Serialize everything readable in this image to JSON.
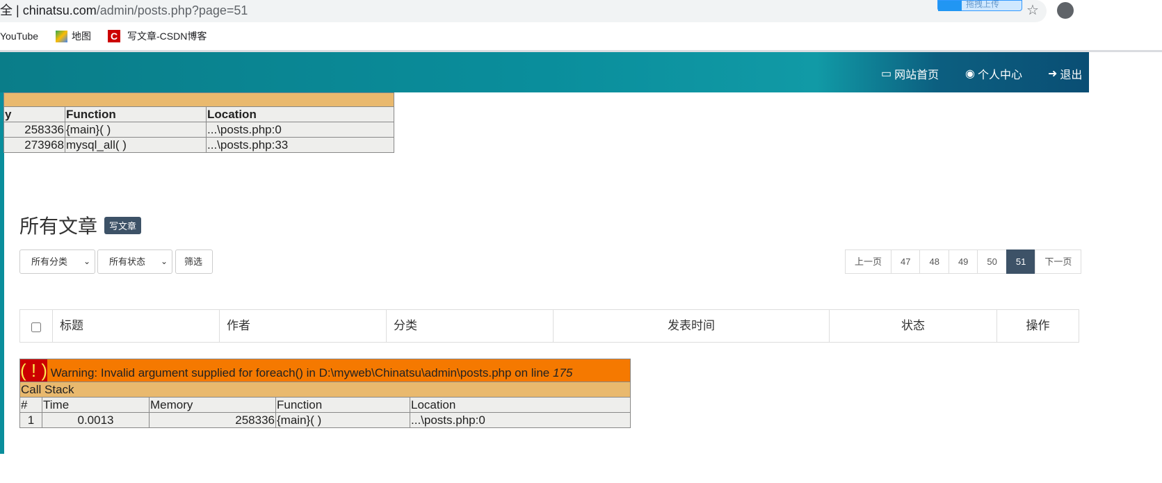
{
  "browser": {
    "address_prefix": "全 | ",
    "address_host": "chinatsu.com",
    "address_path": "/admin/posts.php?page=51",
    "extension_label": "拖拽上传",
    "bookmarks": [
      {
        "label": "YouTube"
      },
      {
        "label": "地图"
      },
      {
        "label": "写文章-CSDN博客"
      }
    ]
  },
  "header": {
    "nav": [
      {
        "label": "网站首页",
        "icon": "monitor-icon"
      },
      {
        "label": "个人中心",
        "icon": "user-circle-icon"
      },
      {
        "label": "退出",
        "icon": "sign-out-icon"
      }
    ]
  },
  "xdebug_top": {
    "headers": [
      "y",
      "Function",
      "Location"
    ],
    "rows": [
      [
        "258336",
        "{main}( )",
        "...\\posts.php:0"
      ],
      [
        "273968",
        "mysql_all( )",
        "...\\posts.php:33"
      ]
    ]
  },
  "page": {
    "title": "所有文章",
    "new_post": "写文章"
  },
  "filters": {
    "category": "所有分类",
    "status": "所有状态",
    "filter_button": "筛选"
  },
  "pagination": {
    "prev": "上一页",
    "pages": [
      "47",
      "48",
      "49",
      "50",
      "51"
    ],
    "current": "51",
    "next": "下一页"
  },
  "table": {
    "headers": [
      "标题",
      "作者",
      "分类",
      "发表时间",
      "状态",
      "操作"
    ]
  },
  "warning": {
    "icon": "( ! )",
    "message": "Warning: Invalid argument supplied for foreach() in D:\\myweb\\Chinatsu\\admin\\posts.php on line ",
    "line": "175",
    "call_stack": "Call Stack",
    "headers": [
      "#",
      "Time",
      "Memory",
      "Function",
      "Location"
    ],
    "rows": [
      [
        "1",
        "0.0013",
        "258336",
        "{main}( )",
        "...\\posts.php:0"
      ]
    ]
  },
  "colors": {
    "header": "#0a8e9c",
    "warning": "#f57900",
    "callstack": "#e9b96e",
    "badge": "#3d5267"
  }
}
